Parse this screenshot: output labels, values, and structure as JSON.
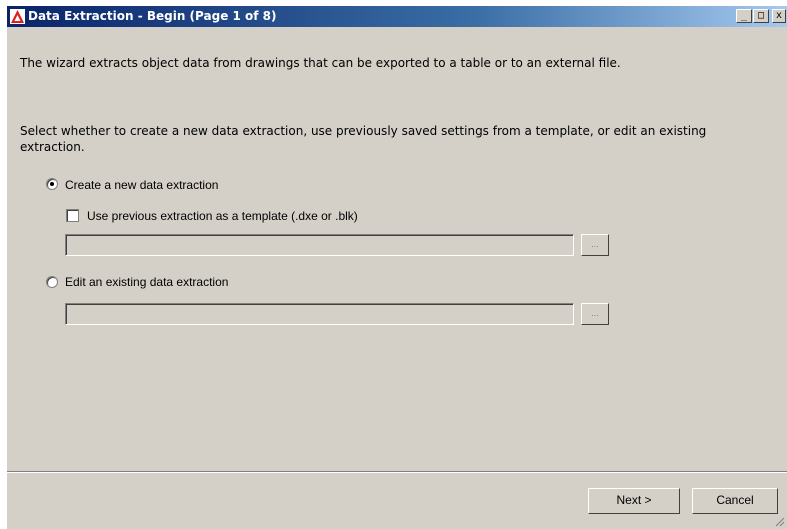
{
  "window": {
    "title": "Data Extraction - Begin (Page 1 of 8)",
    "controls": {
      "minimize": "_",
      "maximize": "□",
      "close": "x"
    }
  },
  "intro_text": "The wizard extracts object data from drawings that can be exported to a table or to an external file.",
  "select_text_line1": "Select whether to create a new data extraction, use previously saved settings from a template, or edit an existing",
  "select_text_line2": "extraction.",
  "options": {
    "create_new": {
      "label": "Create a new data extraction",
      "selected": true
    },
    "use_template": {
      "label": "Use previous extraction as a template (.dxe or .blk)",
      "checked": false
    },
    "template_path": {
      "value": ""
    },
    "template_browse": "...",
    "edit_existing": {
      "label": "Edit an existing data extraction",
      "selected": false
    },
    "existing_path": {
      "value": ""
    },
    "existing_browse": "..."
  },
  "buttons": {
    "next": "Next >",
    "cancel": "Cancel"
  },
  "icons": {
    "app": "autocad-app-icon",
    "grip": "resize-grip-icon"
  }
}
